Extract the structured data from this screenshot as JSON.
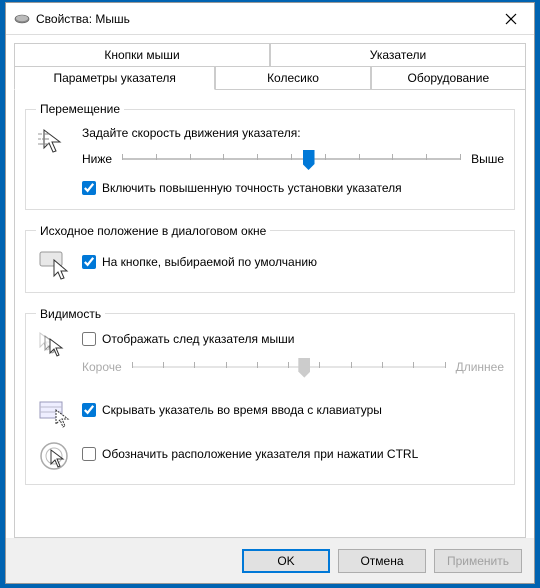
{
  "window": {
    "title": "Свойства: Мышь"
  },
  "tabs": {
    "buttons": "Кнопки мыши",
    "pointers": "Указатели",
    "pointer_options": "Параметры указателя",
    "wheel": "Колесико",
    "hardware": "Оборудование"
  },
  "motion": {
    "legend": "Перемещение",
    "speed_label": "Задайте скорость движения указателя:",
    "slow": "Ниже",
    "fast": "Выше",
    "enhance": "Включить повышенную точность установки указателя",
    "slider_pos_pct": 55
  },
  "snap": {
    "legend": "Исходное положение в диалоговом окне",
    "label": "На кнопке, выбираемой по умолчанию"
  },
  "visibility": {
    "legend": "Видимость",
    "trails": "Отображать след указателя мыши",
    "short": "Короче",
    "long": "Длиннее",
    "hide_typing": "Скрывать указатель во время ввода с клавиатуры",
    "ctrl_locate": "Обозначить расположение указателя при нажатии CTRL"
  },
  "buttons_bar": {
    "ok": "OK",
    "cancel": "Отмена",
    "apply": "Применить"
  },
  "colors": {
    "accent": "#0078d7"
  }
}
